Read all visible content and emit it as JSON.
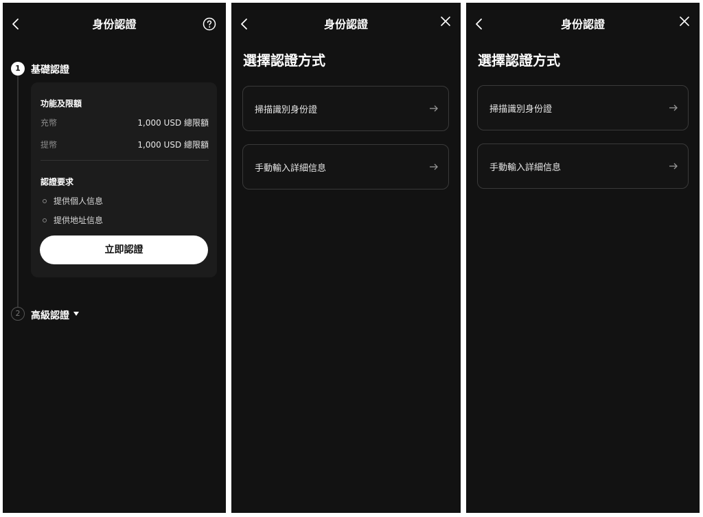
{
  "screens": [
    {
      "nav": {
        "title": "身份認證"
      },
      "steps": [
        {
          "number": "1",
          "title": "基礎認證"
        },
        {
          "number": "2",
          "title": "高級認證"
        }
      ],
      "card": {
        "limits_title": "功能及限額",
        "limits": [
          {
            "label": "充幣",
            "value": "1,000 USD 總限額"
          },
          {
            "label": "提幣",
            "value": "1,000 USD 總限額"
          }
        ],
        "requirements_title": "認證要求",
        "requirements": [
          "提供個人信息",
          "提供地址信息"
        ],
        "button_label": "立即認證"
      }
    },
    {
      "nav": {
        "title": "身份認證"
      },
      "heading": "選擇認證方式",
      "options": [
        {
          "label": "掃描識別身份證"
        },
        {
          "label": "手動輸入詳細信息"
        }
      ]
    },
    {
      "nav": {
        "title": "身份認證"
      },
      "heading": "選擇認證方式",
      "options": [
        {
          "label": "掃描識別身份證"
        },
        {
          "label": "手動輸入詳細信息"
        }
      ]
    }
  ],
  "icons": {
    "back": "chevron-left-icon",
    "help": "question-circle-icon",
    "close": "close-icon",
    "arrow": "arrow-right-icon",
    "caret": "caret-down-icon"
  },
  "colors": {
    "background": "#121212",
    "card": "#1c1c1c",
    "primary_button": "#ffffff",
    "option_border": "#3a3a3a"
  }
}
